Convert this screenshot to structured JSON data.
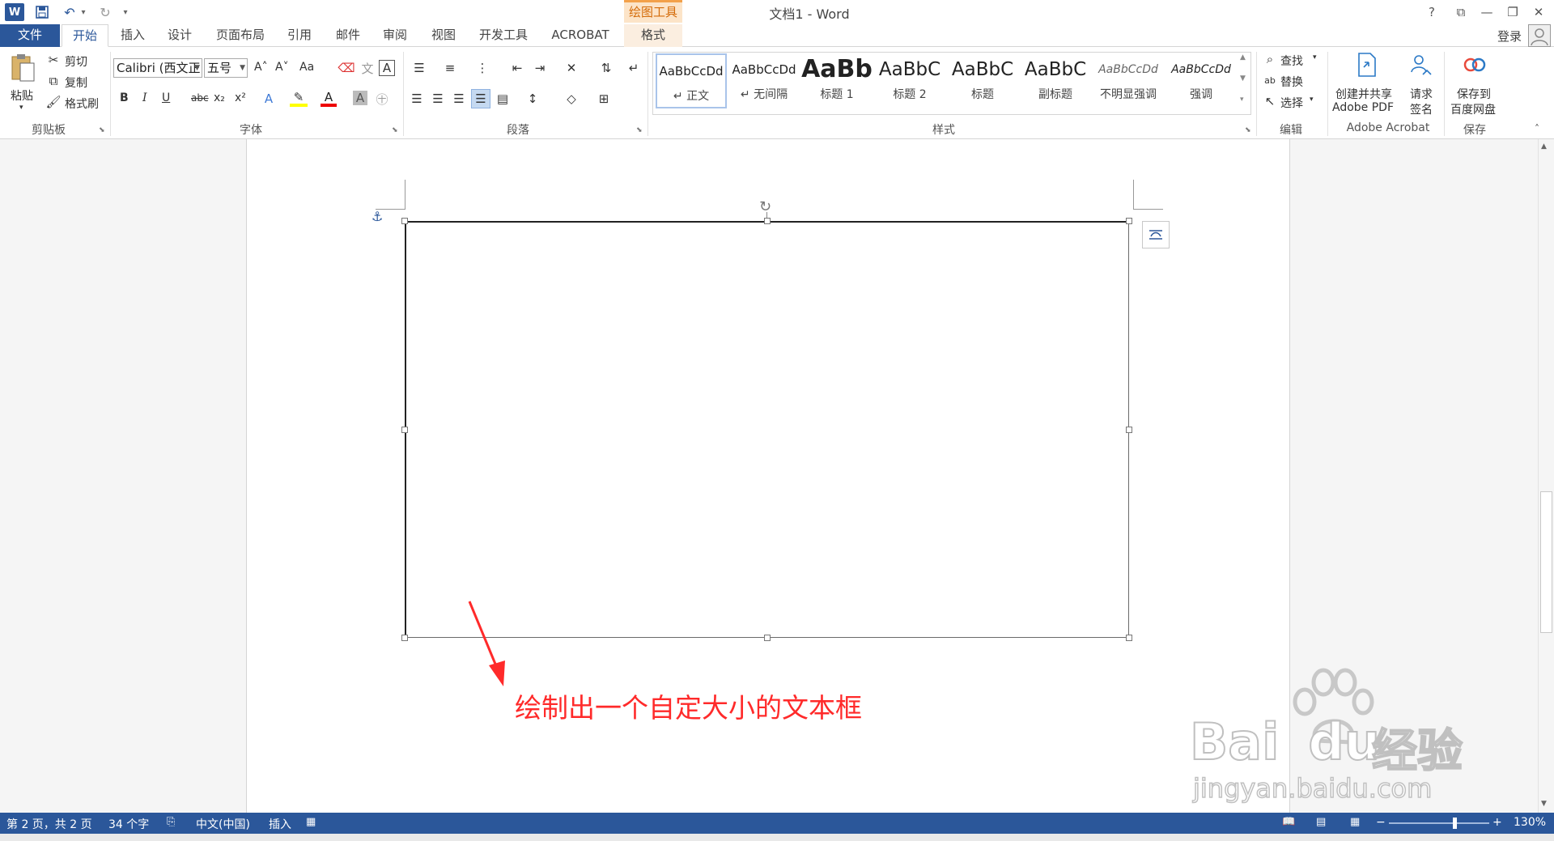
{
  "window": {
    "title": "文档1 - Word",
    "context_tools": "绘图工具",
    "help": "?",
    "ribbon_display": "⧉",
    "minimize": "—",
    "restore": "❐",
    "close": "✕",
    "login": "登录"
  },
  "quick_access": {
    "customize": "▾"
  },
  "tabs": [
    "文件",
    "开始",
    "插入",
    "设计",
    "页面布局",
    "引用",
    "邮件",
    "审阅",
    "视图",
    "开发工具",
    "ACROBAT",
    "格式"
  ],
  "ribbon": {
    "clipboard": {
      "paste": "粘贴",
      "cut": "剪切",
      "copy": "复制",
      "format_painter": "格式刷",
      "label": "剪贴板"
    },
    "font": {
      "font_name": "Calibri (西文正",
      "font_size": "五号",
      "grow": "A˄",
      "shrink": "A˅",
      "case": "Aa",
      "bold": "B",
      "italic": "I",
      "underline": "U",
      "strike": "abc",
      "subscript": "x₂",
      "superscript": "x²",
      "label": "字体"
    },
    "paragraph": {
      "label": "段落"
    },
    "styles": {
      "items": [
        {
          "sample": "AaBbCcDd",
          "name": "↵ 正文"
        },
        {
          "sample": "AaBbCcDd",
          "name": "↵ 无间隔"
        },
        {
          "sample": "AaBb",
          "name": "标题 1"
        },
        {
          "sample": "AaBbC",
          "name": "标题 2"
        },
        {
          "sample": "AaBbC",
          "name": "标题"
        },
        {
          "sample": "AaBbC",
          "name": "副标题"
        },
        {
          "sample": "AaBbCcDd",
          "name": "不明显强调"
        },
        {
          "sample": "AaBbCcDd",
          "name": "强调"
        }
      ],
      "label": "样式"
    },
    "editing": {
      "find": "查找",
      "replace": "替换",
      "select": "选择",
      "label": "编辑"
    },
    "acrobat": {
      "create_pdf_line1": "创建并共享",
      "create_pdf_line2": "Adobe PDF",
      "sign_line1": "请求",
      "sign_line2": "签名",
      "label": "Adobe Acrobat"
    },
    "save": {
      "line1": "保存到",
      "line2": "百度网盘",
      "label": "保存"
    }
  },
  "document": {
    "annotation": "绘制出一个自定大小的文本框"
  },
  "watermark": {
    "brand": "Bai",
    "brand2": "du",
    "cn": "经验",
    "url": "jingyan.baidu.com"
  },
  "status": {
    "page": "第 2 页，共 2 页",
    "words": "34 个字",
    "language": "中文(中国)",
    "mode": "插入",
    "zoom": "130%",
    "zoom_level": 0.65
  }
}
